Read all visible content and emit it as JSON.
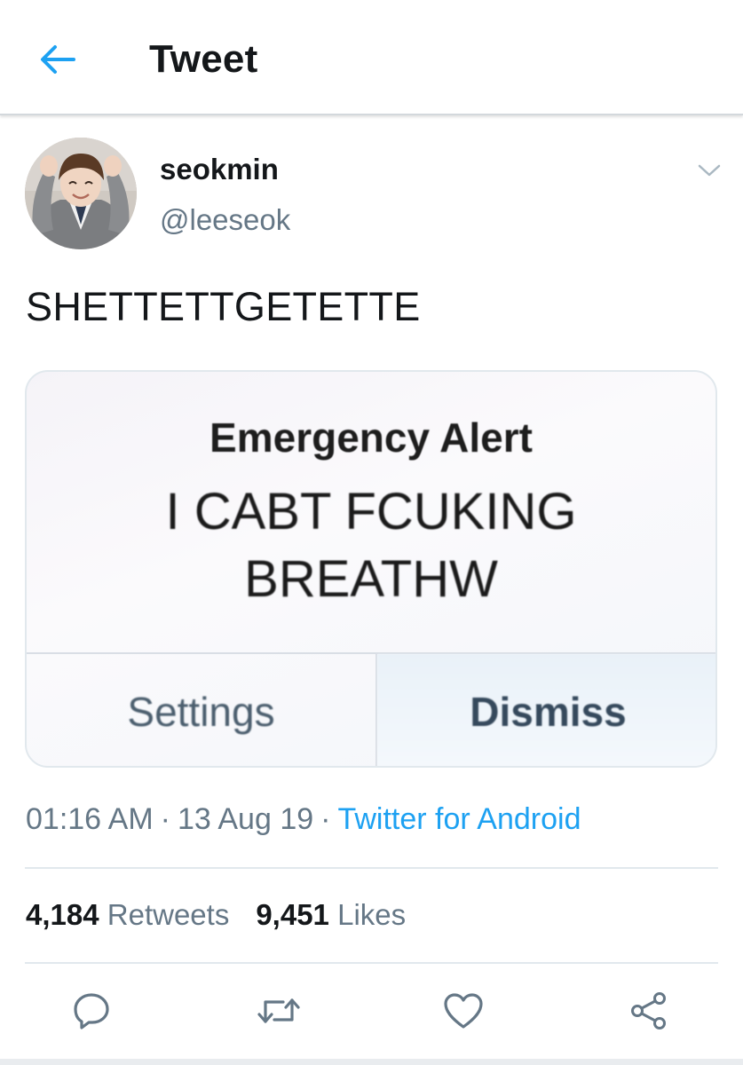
{
  "header": {
    "title": "Tweet",
    "back_icon": "back-arrow-icon",
    "accent_color": "#1da1f2"
  },
  "tweet": {
    "author": {
      "display_name": "seokmin",
      "handle": "@leeseok"
    },
    "text": "SHETTETTGETETTE",
    "media": {
      "alert_title": "Emergency Alert",
      "alert_body_line1": "I CABT FCUKING",
      "alert_body_line2": "BREATHW",
      "left_button": "Settings",
      "right_button": "Dismiss"
    },
    "time": "01:16 AM",
    "date": "13 Aug 19",
    "separator": "·",
    "source": "Twitter for Android",
    "stats": {
      "retweets_count": "4,184",
      "retweets_label": "Retweets",
      "likes_count": "9,451",
      "likes_label": "Likes"
    }
  },
  "actions": {
    "reply_icon": "reply-icon",
    "retweet_icon": "retweet-icon",
    "like_icon": "heart-icon",
    "share_icon": "share-icon"
  }
}
